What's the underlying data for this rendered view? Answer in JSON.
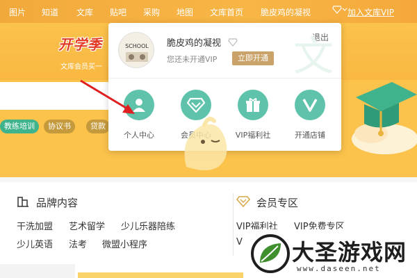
{
  "topbar": {
    "nav": [
      "图片",
      "知道",
      "文库",
      "贴吧",
      "采购",
      "地图",
      "文库首页"
    ],
    "username": "脆皮鸡的凝视",
    "join_vip": "加入文库VIP"
  },
  "banner": {
    "logo_text": "开学季",
    "subtitle": "文库会员买一"
  },
  "tags": [
    {
      "label": "教练培训",
      "color": "#3fb38c"
    },
    {
      "label": "协议书",
      "color": "#c59a3d"
    },
    {
      "label": "贷款",
      "color": "#c59a3d"
    }
  ],
  "popup": {
    "avatar_text": "SCHOOL",
    "username": "脆皮鸡的凝视",
    "vip_status": "您还未开通VIP",
    "open_button": "立即开通",
    "logout": "退出",
    "features": [
      {
        "label": "个人中心",
        "icon": "person-icon"
      },
      {
        "label": "会员中心",
        "icon": "diamond-icon"
      },
      {
        "label": "VIP福利社",
        "icon": "gift-icon"
      },
      {
        "label": "开通店铺",
        "icon": "v-icon"
      }
    ],
    "accent": "#5fc3ab"
  },
  "content": {
    "brand": {
      "title": "品牌内容",
      "links_row1": [
        "干洗加盟",
        "艺术留学",
        "少儿乐器陪练"
      ],
      "links_row2": [
        "少儿英语",
        "法考",
        "微盟小程序"
      ]
    },
    "member": {
      "title": "会员专区",
      "links_row1": [
        "VIP福利社",
        "VIP免费专区"
      ],
      "links_row2": [
        "VI"
      ]
    }
  },
  "watermark": {
    "title": "大圣游戏网",
    "url": "www.daseen.net"
  }
}
